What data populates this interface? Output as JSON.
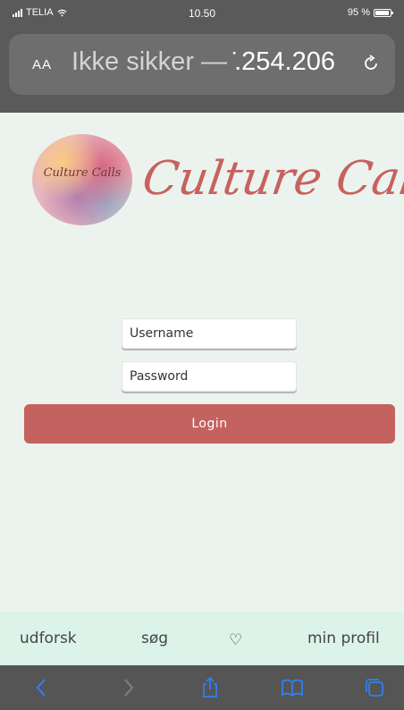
{
  "status_bar": {
    "carrier": "TELIA",
    "time": "10.50",
    "battery": "95 %",
    "battery_level": 0.95
  },
  "url_bar": {
    "text_size_label": "AA",
    "security_label": "Ikke sikker —",
    "url_fragment": " ̇.254.206",
    "reload_icon": "reload-icon"
  },
  "page": {
    "logo_text": "Culture Calls",
    "brand_title": "Culture Calls",
    "username_placeholder": "Username",
    "password_placeholder": "Password",
    "login_label": "Login"
  },
  "app_nav": {
    "items": [
      {
        "label": "udforsk"
      },
      {
        "label": "søg"
      },
      {
        "label": "♡"
      },
      {
        "label": "min profil"
      }
    ]
  },
  "toolbar": {
    "icons": [
      "back-icon",
      "forward-icon",
      "share-icon",
      "bookmarks-icon",
      "tabs-icon"
    ]
  },
  "colors": {
    "accent": "#c4625f",
    "page_background": "#ecf3ee",
    "nav_background": "#dcf3ea",
    "safari_chrome": "#5a5a5a",
    "toolbar_icon": "#2f7ff2"
  }
}
